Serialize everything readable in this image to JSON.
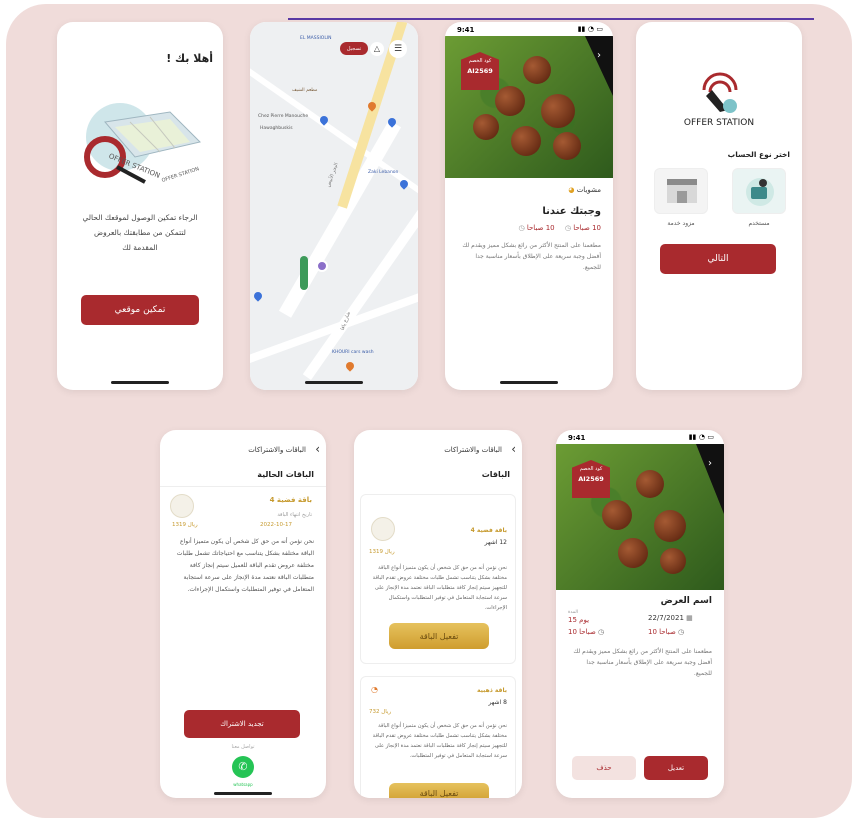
{
  "colors": {
    "primary": "#a92a2e",
    "board": "#f0dcda",
    "gold": "#d4a63c"
  },
  "screen_welcome": {
    "title": "أهلا بك !",
    "brand_text": "OFFER STATION",
    "brand_text_2": "OFFER STATION",
    "message_line1": "الرجاء تمكين الوصول لموقعك الحالي",
    "message_line2": "لتتمكن من مطابقتك بالعروض",
    "message_line3": "المقدمة لك",
    "enable_button": "تمكين موقعي"
  },
  "screen_map": {
    "login_button": "تسجيل",
    "label_top": "EL MASSIOLIN",
    "place1": "مطعم الشيف",
    "place2": "Chez Pierre Manouche",
    "place3": "Hawaghbuskis",
    "place4": "Zaki Lebanon",
    "place5": "KHOURI cars wash",
    "street1": "البحر الأبيض",
    "street2": "شارع يافا"
  },
  "screen_meal": {
    "time": "9:41",
    "code_label": "كود الخصم",
    "code": "AI2569",
    "vendor": "مشويات",
    "title": "وجبتك عندنا",
    "time_range_start": "10 صباحا",
    "time_range_end": "10 صباحا",
    "description": "مطعمنا على المنتج الأكثر من رائع بشكل مميز ويقدم لك أفضل وجبة سريعة على الإطلاق بأسعار مناسبة جدا للجميع."
  },
  "screen_account": {
    "brand": "OFFER STATION",
    "question": "اختر نوع الحساب",
    "option_user": "مستخدم",
    "option_provider": "مزود خدمة",
    "next_button": "التالي"
  },
  "screen_current": {
    "header": "الباقات والاشتراكات",
    "section": "الباقات الحالية",
    "package_name": "باقة فضية 4",
    "expiry_label": "تاريخ انتهاء الباقة",
    "expiry_date": "2022-10-17",
    "price": "1319 ريال",
    "description": "نحن نؤمن أنه من حق كل شخص أن يكون متميزا أنواع الباقة مختلفة بشكل يتناسب مع احتياجاتك تشمل طلبات مختلفة عروض تقدم الباقة للعميل سيتم إنجاز كافة متطلبات الباقة نعتمد مدة الإنجاز على سرعة استجابة المتعامل في توفير المتطلبات واستكمال الإجراءات.",
    "renew_button": "تجديد الاشتراك",
    "contact_label": "تواصل معنا",
    "whatsapp_label": "whatsapp"
  },
  "screen_packages": {
    "header": "الباقات والاشتراكات",
    "section": "الباقات",
    "pkg1_name": "باقة فضية 4",
    "pkg1_duration": "12 اشهر",
    "pkg1_price": "1319 ريال",
    "pkg1_desc": "نحن نؤمن أنه من حق كل شخص أن يكون متميزا أنواع الباقة مختلفة بشكل يتناسب تشمل طلبات مختلفة عروض تقدم الباقة للتجهيز سيتم إنجاز كافة متطلبات الباقة نعتمد مدة الإنجاز على سرعة استجابة المتعامل في توفير المتطلبات واستكمال الإجراءات.",
    "pkg1_button": "تفعيل الباقة",
    "pkg2_name": "باقة ذهبية",
    "pkg2_duration": "8 اشهر",
    "pkg2_price": "732 ريال",
    "pkg2_desc": "نحن نؤمن أنه من حق كل شخص أن يكون متميزا أنواع الباقة مختلفة بشكل يتناسب تشمل طلبات مختلفة عروض تقدم الباقة للتجهيز سيتم إنجاز كافة متطلبات الباقة نعتمد مدة الإنجاز على سرعة استجابة المتعامل في توفير المتطلبات.",
    "pkg2_button": "تفعيل الباقة"
  },
  "screen_offer": {
    "time": "9:41",
    "code_label": "كود الخصم",
    "code": "AI2569",
    "title": "اسم العرض",
    "date": "22/7/2021",
    "days_label": "المدة",
    "days": "15 يوم",
    "time_from": "10 صباحا",
    "time_to": "10 صباحا",
    "description": "مطعمنا على المنتج الأكثر من رائع بشكل مميز ويقدم لك أفضل وجبة سريعة على الإطلاق بأسعار مناسبة جدا للجميع.",
    "delete_button": "حذف",
    "edit_button": "تعديل"
  }
}
